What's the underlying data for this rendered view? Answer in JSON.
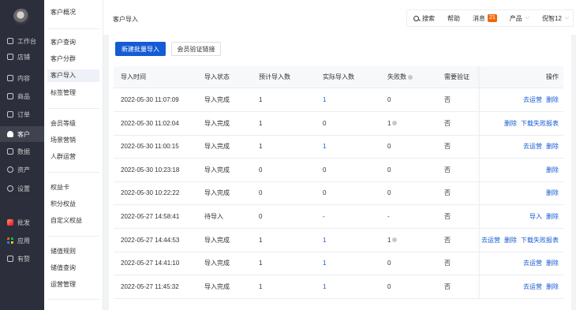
{
  "nav": {
    "items": [
      {
        "label": "工作台",
        "icon": "desktop-icon"
      },
      {
        "label": "店铺",
        "icon": "store-icon"
      },
      {
        "label": "内容",
        "icon": "content-icon"
      },
      {
        "label": "商品",
        "icon": "goods-icon"
      },
      {
        "label": "订单",
        "icon": "order-icon"
      },
      {
        "label": "客户",
        "icon": "user-icon"
      },
      {
        "label": "数据",
        "icon": "chart-icon"
      },
      {
        "label": "资产",
        "icon": "asset-icon"
      },
      {
        "label": "设置",
        "icon": "gear-icon"
      }
    ],
    "bottom": [
      {
        "label": "批发",
        "icon": "wholesale-icon"
      },
      {
        "label": "应用",
        "icon": "apps-icon"
      },
      {
        "label": "有赞",
        "icon": "thumb-icon"
      }
    ]
  },
  "subnav": {
    "groups": [
      [
        "客户概况"
      ],
      [
        "客户查询",
        "客户分群",
        "客户导入",
        "标签管理"
      ],
      [
        "会员等级",
        "场景营销",
        "人群运营"
      ],
      [
        "权益卡",
        "积分权益",
        "自定义权益"
      ],
      [
        "储值规则",
        "储值查询",
        "运营管理"
      ]
    ]
  },
  "header": {
    "title": "客户导入",
    "search": "搜索",
    "help": "帮助",
    "messages": "消息",
    "message_count": "21",
    "product": "产品",
    "user": "倪智12"
  },
  "actions": {
    "primary": "新建批量导入",
    "secondary": "会员验证链接"
  },
  "table": {
    "columns": [
      "导入时间",
      "导入状态",
      "预计导入数",
      "实际导入数",
      "失败数",
      "需要验证",
      "操作"
    ],
    "rows": [
      {
        "time": "2022-05-30 11:07:09",
        "status": "导入完成",
        "expected": "1",
        "actual": "1",
        "failed": "0",
        "verify": "否",
        "ops": [
          "去运营",
          "删除"
        ]
      },
      {
        "time": "2022-05-30 11:02:04",
        "status": "导入完成",
        "expected": "1",
        "actual": "0",
        "failed": "1",
        "verify": "否",
        "ops": [
          "删除",
          "下载失败报表"
        ]
      },
      {
        "time": "2022-05-30 11:00:15",
        "status": "导入完成",
        "expected": "1",
        "actual": "1",
        "failed": "0",
        "verify": "否",
        "ops": [
          "去运营",
          "删除"
        ]
      },
      {
        "time": "2022-05-30 10:23:18",
        "status": "导入完成",
        "expected": "0",
        "actual": "0",
        "failed": "0",
        "verify": "否",
        "ops": [
          "删除"
        ]
      },
      {
        "time": "2022-05-30 10:22:22",
        "status": "导入完成",
        "expected": "0",
        "actual": "0",
        "failed": "0",
        "verify": "否",
        "ops": [
          "删除"
        ]
      },
      {
        "time": "2022-05-27 14:58:41",
        "status": "待导入",
        "expected": "0",
        "actual": "-",
        "failed": "-",
        "verify": "否",
        "ops": [
          "导入",
          "删除"
        ]
      },
      {
        "time": "2022-05-27 14:44:53",
        "status": "导入完成",
        "expected": "1",
        "actual": "1",
        "failed": "1",
        "verify": "否",
        "ops": [
          "去运营",
          "删除",
          "下载失败报表"
        ]
      },
      {
        "time": "2022-05-27 14:41:10",
        "status": "导入完成",
        "expected": "1",
        "actual": "1",
        "failed": "0",
        "verify": "否",
        "ops": [
          "去运营",
          "删除"
        ]
      },
      {
        "time": "2022-05-27 11:45:32",
        "status": "导入完成",
        "expected": "1",
        "actual": "1",
        "failed": "0",
        "verify": "否",
        "ops": [
          "去运营",
          "删除"
        ]
      }
    ]
  }
}
